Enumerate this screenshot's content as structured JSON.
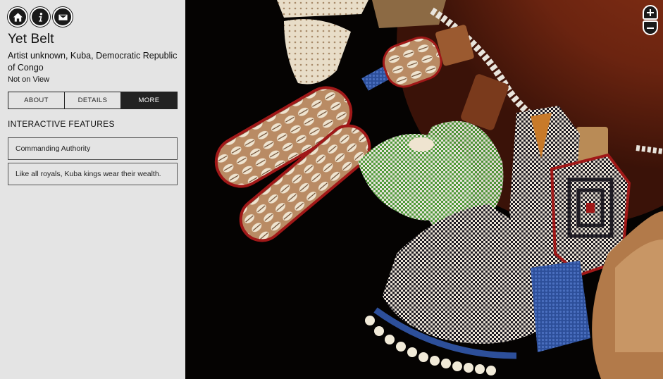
{
  "nav": {
    "home_icon": "home-icon",
    "info_icon": "info-icon",
    "mail_icon": "mail-icon"
  },
  "object": {
    "title": "Yet Belt",
    "artist": "Artist unknown, Kuba, Democratic Republic of Congo",
    "status": "Not on View"
  },
  "tabs": [
    {
      "label": "ABOUT",
      "active": false
    },
    {
      "label": "DETAILS",
      "active": false
    },
    {
      "label": "MORE",
      "active": true
    }
  ],
  "interactive": {
    "heading": "INTERACTIVE FEATURES",
    "items": [
      {
        "label": "Commanding Authority"
      },
      {
        "label": "Like all royals, Kuba kings wear their wealth."
      }
    ]
  },
  "viewer": {
    "zoom_in_icon": "plus-icon",
    "zoom_out_icon": "minus-icon"
  },
  "colors": {
    "sidebar_bg": "#e4e4e4",
    "active_tab": "#222222",
    "leather": "#7a2a14",
    "beads_blue": "#2d4f9a",
    "beads_green": "#4f9a3a"
  }
}
